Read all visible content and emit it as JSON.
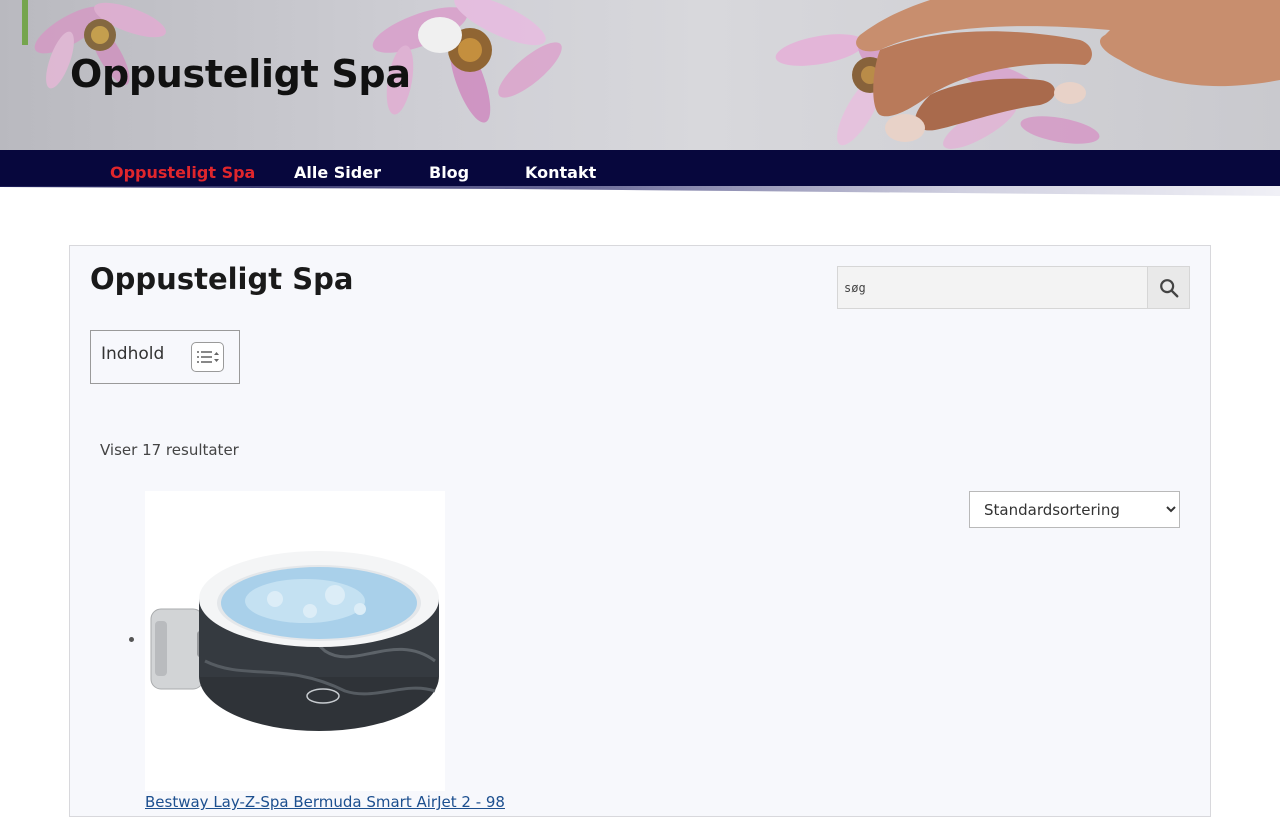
{
  "header": {
    "site_title": "Oppusteligt Spa"
  },
  "nav": {
    "items": [
      {
        "label": "Oppusteligt Spa",
        "active": true
      },
      {
        "label": "Alle Sider",
        "active": false
      },
      {
        "label": "Blog",
        "active": false
      },
      {
        "label": "Kontakt",
        "active": false
      }
    ]
  },
  "main": {
    "page_title": "Oppusteligt Spa",
    "search": {
      "value": "søg"
    },
    "toc": {
      "title": "Indhold"
    },
    "result_count": "Viser 17 resultater",
    "sort": {
      "selected": "Standardsortering"
    },
    "products": [
      {
        "name": "Bestway Lay-Z-Spa Bermuda Smart AirJet 2 - 98"
      }
    ]
  },
  "colors": {
    "nav_background": "#07073d",
    "nav_active": "#e0262c",
    "panel_background": "#f7f8fc",
    "link": "#1c4f8f"
  }
}
